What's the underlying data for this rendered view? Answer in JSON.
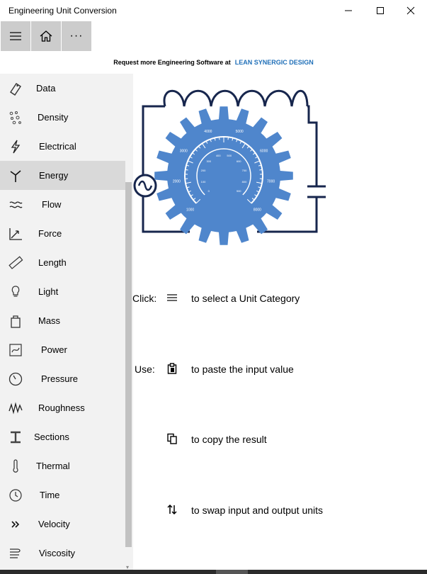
{
  "window": {
    "title": "Engineering Unit Conversion"
  },
  "commandbar": {
    "menu_icon": "hamburger-icon",
    "home_icon": "home-icon",
    "more_icon": "more-icon",
    "more_label": "···"
  },
  "promo": {
    "text": "Request more Engineering Software at",
    "link": "LEAN SYNERGIC DESIGN"
  },
  "sidebar": {
    "items": [
      {
        "label": "Data",
        "icon": "tag-icon"
      },
      {
        "label": "Density",
        "icon": "density-dots-icon"
      },
      {
        "label": "Electrical",
        "icon": "lightning-icon"
      },
      {
        "label": "Energy",
        "icon": "wind-turbine-icon",
        "selected": true
      },
      {
        "label": "Flow",
        "icon": "flow-waves-icon"
      },
      {
        "label": "Force",
        "icon": "force-vector-icon"
      },
      {
        "label": "Length",
        "icon": "ruler-icon"
      },
      {
        "label": "Light",
        "icon": "light-bulb-icon"
      },
      {
        "label": "Mass",
        "icon": "mass-weight-icon"
      },
      {
        "label": "Power",
        "icon": "power-icon"
      },
      {
        "label": "Pressure",
        "icon": "pressure-gauge-icon"
      },
      {
        "label": "Roughness",
        "icon": "roughness-icon"
      },
      {
        "label": "Sections",
        "icon": "i-beam-icon"
      },
      {
        "label": "Thermal",
        "icon": "thermometer-icon"
      },
      {
        "label": "Time",
        "icon": "clock-icon"
      },
      {
        "label": "Velocity",
        "icon": "velocity-chevrons-icon"
      },
      {
        "label": "Viscosity",
        "icon": "viscosity-icon"
      }
    ]
  },
  "gauge": {
    "outer_labels": [
      "1000",
      "2000",
      "3000",
      "4000",
      "5000",
      "6000",
      "7000",
      "8000"
    ],
    "inner_labels": [
      "0",
      "100",
      "200",
      "300",
      "400",
      "500",
      "600",
      "700",
      "800",
      "900"
    ]
  },
  "instructions": {
    "click_label": "Click:",
    "click_text": "to select a Unit Category",
    "use_label": "Use:",
    "paste_text": "to paste the input value",
    "copy_text": "to copy the result",
    "swap_text": "to swap input and output units"
  },
  "colors": {
    "accent": "#1f6fb8",
    "gear": "#4f86cc",
    "circuit": "#17264d",
    "selected": "#d9d9d9",
    "sidebar": "#f2f2f2"
  }
}
